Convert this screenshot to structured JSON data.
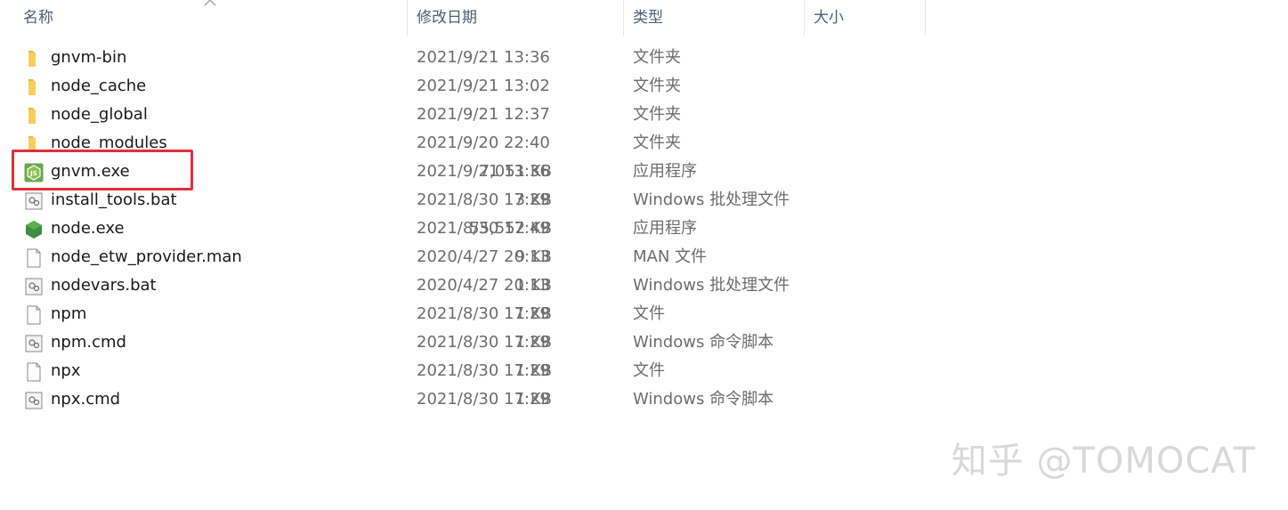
{
  "columns": {
    "name": "名称",
    "date": "修改日期",
    "type": "类型",
    "size": "大小"
  },
  "files": [
    {
      "name": "gnvm-bin",
      "date": "2021/9/21 13:36",
      "type": "文件夹",
      "size": "",
      "icon": "folder-icon"
    },
    {
      "name": "node_cache",
      "date": "2021/9/21 13:02",
      "type": "文件夹",
      "size": "",
      "icon": "folder-icon"
    },
    {
      "name": "node_global",
      "date": "2021/9/21 12:37",
      "type": "文件夹",
      "size": "",
      "icon": "folder-icon"
    },
    {
      "name": "node_modules",
      "date": "2021/9/20 22:40",
      "type": "文件夹",
      "size": "",
      "icon": "folder-icon"
    },
    {
      "name": "gnvm.exe",
      "date": "2021/9/21 13:36",
      "type": "应用程序",
      "size": "7,051 KB",
      "icon": "gnvm-exe-icon"
    },
    {
      "name": "install_tools.bat",
      "date": "2021/8/30 17:29",
      "type": "Windows 批处理文件",
      "size": "3 KB",
      "icon": "batch-file-icon"
    },
    {
      "name": "node.exe",
      "date": "2021/8/30 17:49",
      "type": "应用程序",
      "size": "55,552 KB",
      "icon": "node-exe-icon"
    },
    {
      "name": "node_etw_provider.man",
      "date": "2020/4/27 20:13",
      "type": "MAN 文件",
      "size": "9 KB",
      "icon": "blank-file-icon"
    },
    {
      "name": "nodevars.bat",
      "date": "2020/4/27 20:13",
      "type": "Windows 批处理文件",
      "size": "1 KB",
      "icon": "batch-file-icon"
    },
    {
      "name": "npm",
      "date": "2021/8/30 17:29",
      "type": "文件",
      "size": "1 KB",
      "icon": "blank-file-icon"
    },
    {
      "name": "npm.cmd",
      "date": "2021/8/30 17:29",
      "type": "Windows 命令脚本",
      "size": "1 KB",
      "icon": "batch-file-icon"
    },
    {
      "name": "npx",
      "date": "2021/8/30 17:29",
      "type": "文件",
      "size": "1 KB",
      "icon": "blank-file-icon"
    },
    {
      "name": "npx.cmd",
      "date": "2021/8/30 17:29",
      "type": "Windows 命令脚本",
      "size": "1 KB",
      "icon": "batch-file-icon"
    }
  ],
  "watermark": "知乎 @TOMOCAT",
  "colors": {
    "highlight": "#e0303a",
    "folder": "#f2c14e",
    "node_green": "#3e8e41",
    "header_text": "#4c607a"
  }
}
